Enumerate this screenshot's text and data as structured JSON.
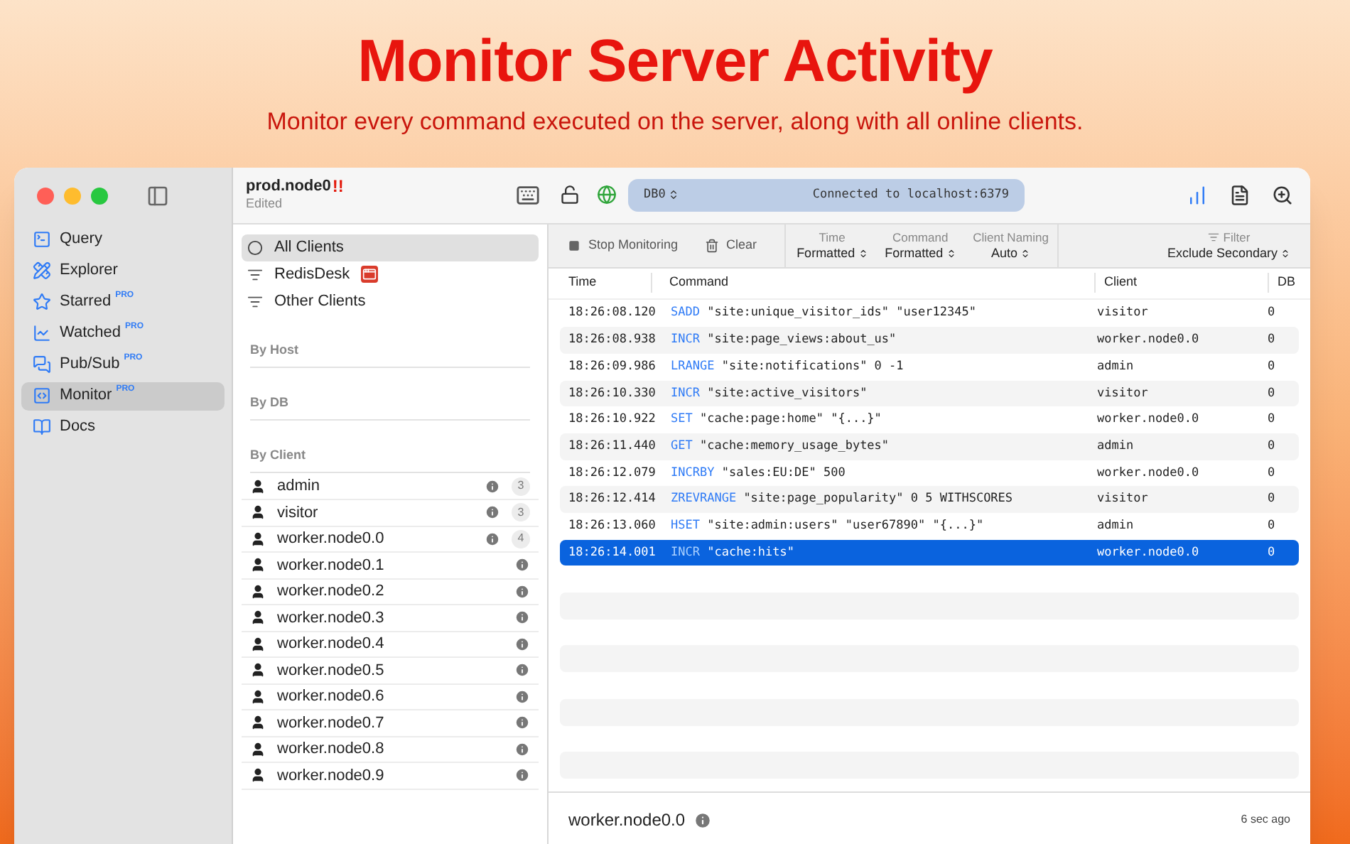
{
  "hero": {
    "title": "Monitor Server Activity",
    "subtitle": "Monitor every command executed on the server, along with all online clients."
  },
  "sidebar": {
    "items": [
      {
        "label": "Query",
        "selected": false
      },
      {
        "label": "Explorer",
        "selected": false
      },
      {
        "label": "Starred",
        "badge": "PRO",
        "selected": false
      },
      {
        "label": "Watched",
        "badge": "PRO",
        "selected": false
      },
      {
        "label": "Pub/Sub",
        "badge": "PRO",
        "selected": false
      },
      {
        "label": "Monitor",
        "badge": "PRO",
        "selected": true
      },
      {
        "label": "Docs",
        "selected": false
      }
    ]
  },
  "header": {
    "title": "prod.node0",
    "alert": "!!",
    "subtitle": "Edited",
    "db": "DB0",
    "status": "Connected to localhost:6379"
  },
  "filters": [
    {
      "label": "All Clients",
      "kind": "all",
      "app_badge": false,
      "selected": true
    },
    {
      "label": "RedisDesk",
      "kind": "group",
      "app_badge": true,
      "selected": false
    },
    {
      "label": "Other Clients",
      "kind": "group",
      "app_badge": false,
      "selected": false
    }
  ],
  "sections": {
    "host": "By Host",
    "db": "By DB",
    "client": "By Client"
  },
  "clients": [
    {
      "name": "admin",
      "count": "3"
    },
    {
      "name": "visitor",
      "count": "3"
    },
    {
      "name": "worker.node0.0",
      "count": "4"
    },
    {
      "name": "worker.node0.1"
    },
    {
      "name": "worker.node0.2"
    },
    {
      "name": "worker.node0.3"
    },
    {
      "name": "worker.node0.4"
    },
    {
      "name": "worker.node0.5"
    },
    {
      "name": "worker.node0.6"
    },
    {
      "name": "worker.node0.7"
    },
    {
      "name": "worker.node0.8"
    },
    {
      "name": "worker.node0.9"
    }
  ],
  "toolbar": {
    "stop": "Stop Monitoring",
    "clear": "Clear",
    "selectors": [
      {
        "label": "Time",
        "value": "Formatted"
      },
      {
        "label": "Command",
        "value": "Formatted"
      },
      {
        "label": "Client Naming",
        "value": "Auto"
      }
    ],
    "filter": {
      "label": "Filter",
      "value": "Exclude Secondary"
    }
  },
  "table": {
    "columns": [
      "Time",
      "Command",
      "Client",
      "DB"
    ],
    "rows": [
      {
        "time": "18:26:08.120",
        "command": "SADD",
        "args": "\"site:unique_visitor_ids\" \"user12345\"",
        "client": "visitor",
        "db": "0",
        "selected": false
      },
      {
        "time": "18:26:08.938",
        "command": "INCR",
        "args": "\"site:page_views:about_us\"",
        "client": "worker.node0.0",
        "db": "0",
        "selected": false
      },
      {
        "time": "18:26:09.986",
        "command": "LRANGE",
        "args": "\"site:notifications\" 0 -1",
        "client": "admin",
        "db": "0",
        "selected": false
      },
      {
        "time": "18:26:10.330",
        "command": "INCR",
        "args": "\"site:active_visitors\"",
        "client": "visitor",
        "db": "0",
        "selected": false
      },
      {
        "time": "18:26:10.922",
        "command": "SET",
        "args": "\"cache:page:home\" \"{...}\"",
        "client": "worker.node0.0",
        "db": "0",
        "selected": false
      },
      {
        "time": "18:26:11.440",
        "command": "GET",
        "args": "\"cache:memory_usage_bytes\"",
        "client": "admin",
        "db": "0",
        "selected": false
      },
      {
        "time": "18:26:12.079",
        "command": "INCRBY",
        "args": "\"sales:EU:DE\" 500",
        "client": "worker.node0.0",
        "db": "0",
        "selected": false
      },
      {
        "time": "18:26:12.414",
        "command": "ZREVRANGE",
        "args": "\"site:page_popularity\" 0 5 WITHSCORES",
        "client": "visitor",
        "db": "0",
        "selected": false
      },
      {
        "time": "18:26:13.060",
        "command": "HSET",
        "args": "\"site:admin:users\" \"user67890\" \"{...}\"",
        "client": "admin",
        "db": "0",
        "selected": false
      },
      {
        "time": "18:26:14.001",
        "command": "INCR",
        "args": "\"cache:hits\"",
        "client": "worker.node0.0",
        "db": "0",
        "selected": true
      }
    ]
  },
  "footer": {
    "client": "worker.node0.0",
    "time": "6 sec ago"
  }
}
